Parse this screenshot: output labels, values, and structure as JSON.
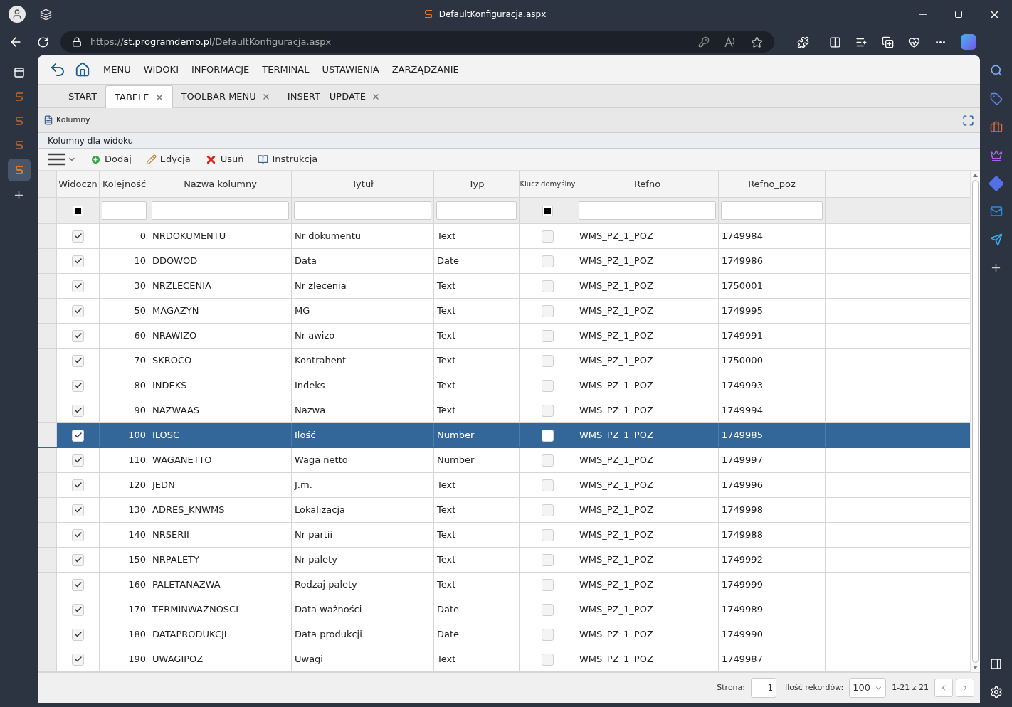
{
  "browser": {
    "title": "DefaultKonfiguracja.aspx",
    "url": {
      "scheme": "https://",
      "host": "st.programdemo.pl",
      "path": "/DefaultKonfiguracja.aspx"
    }
  },
  "nav": [
    "MENU",
    "WIDOKI",
    "INFORMACJE",
    "TERMINAL",
    "USTAWIENIA",
    "ZARZĄDZANIE"
  ],
  "tabs": [
    {
      "label": "START",
      "selected": false,
      "closable": false
    },
    {
      "label": "TABELE",
      "selected": true,
      "closable": true
    },
    {
      "label": "TOOLBAR MENU",
      "selected": false,
      "closable": true
    },
    {
      "label": "INSERT - UPDATE",
      "selected": false,
      "closable": true
    }
  ],
  "panel": {
    "title": "Kolumny",
    "subtitle": "Kolumny dla widoku"
  },
  "toolbar": [
    {
      "kind": "add",
      "label": "Dodaj"
    },
    {
      "kind": "edit",
      "label": "Edycja"
    },
    {
      "kind": "delete",
      "label": "Usuń"
    },
    {
      "kind": "help",
      "label": "Instrukcja"
    }
  ],
  "table": {
    "columns": [
      "Widoczn",
      "Kolejność",
      "Nazwa kolumny",
      "Tytuł",
      "Typ",
      "Klucz domyślny",
      "Refno",
      "Refno_poz"
    ],
    "filter": {
      "visible_checked": true,
      "key_checked": true
    },
    "rows": [
      {
        "visible": true,
        "order": "0",
        "name": "NRDOKUMENTU",
        "title": "Nr dokumentu",
        "type": "Text",
        "key": false,
        "refno": "WMS_PZ_1_POZ",
        "refno_poz": "1749984",
        "selected": false
      },
      {
        "visible": true,
        "order": "10",
        "name": "DDOWOD",
        "title": "Data",
        "type": "Date",
        "key": false,
        "refno": "WMS_PZ_1_POZ",
        "refno_poz": "1749986",
        "selected": false
      },
      {
        "visible": true,
        "order": "30",
        "name": "NRZLECENIA",
        "title": "Nr zlecenia",
        "type": "Text",
        "key": false,
        "refno": "WMS_PZ_1_POZ",
        "refno_poz": "1750001",
        "selected": false
      },
      {
        "visible": true,
        "order": "50",
        "name": "MAGAZYN",
        "title": "MG",
        "type": "Text",
        "key": false,
        "refno": "WMS_PZ_1_POZ",
        "refno_poz": "1749995",
        "selected": false
      },
      {
        "visible": true,
        "order": "60",
        "name": "NRAWIZO",
        "title": "Nr awizo",
        "type": "Text",
        "key": false,
        "refno": "WMS_PZ_1_POZ",
        "refno_poz": "1749991",
        "selected": false
      },
      {
        "visible": true,
        "order": "70",
        "name": "SKROCO",
        "title": "Kontrahent",
        "type": "Text",
        "key": false,
        "refno": "WMS_PZ_1_POZ",
        "refno_poz": "1750000",
        "selected": false
      },
      {
        "visible": true,
        "order": "80",
        "name": "INDEKS",
        "title": "Indeks",
        "type": "Text",
        "key": false,
        "refno": "WMS_PZ_1_POZ",
        "refno_poz": "1749993",
        "selected": false
      },
      {
        "visible": true,
        "order": "90",
        "name": "NAZWAAS",
        "title": "Nazwa",
        "type": "Text",
        "key": false,
        "refno": "WMS_PZ_1_POZ",
        "refno_poz": "1749994",
        "selected": false
      },
      {
        "visible": true,
        "order": "100",
        "name": "ILOSC",
        "title": "Ilość",
        "type": "Number",
        "key": false,
        "refno": "WMS_PZ_1_POZ",
        "refno_poz": "1749985",
        "selected": true
      },
      {
        "visible": true,
        "order": "110",
        "name": "WAGANETTO",
        "title": "Waga netto",
        "type": "Number",
        "key": false,
        "refno": "WMS_PZ_1_POZ",
        "refno_poz": "1749997",
        "selected": false
      },
      {
        "visible": true,
        "order": "120",
        "name": "JEDN",
        "title": "J.m.",
        "type": "Text",
        "key": false,
        "refno": "WMS_PZ_1_POZ",
        "refno_poz": "1749996",
        "selected": false
      },
      {
        "visible": true,
        "order": "130",
        "name": "ADRES_KNWMS",
        "title": "Lokalizacja",
        "type": "Text",
        "key": false,
        "refno": "WMS_PZ_1_POZ",
        "refno_poz": "1749998",
        "selected": false
      },
      {
        "visible": true,
        "order": "140",
        "name": "NRSERII",
        "title": "Nr partii",
        "type": "Text",
        "key": false,
        "refno": "WMS_PZ_1_POZ",
        "refno_poz": "1749988",
        "selected": false
      },
      {
        "visible": true,
        "order": "150",
        "name": "NRPALETY",
        "title": "Nr palety",
        "type": "Text",
        "key": false,
        "refno": "WMS_PZ_1_POZ",
        "refno_poz": "1749992",
        "selected": false
      },
      {
        "visible": true,
        "order": "160",
        "name": "PALETANAZWA",
        "title": "Rodzaj palety",
        "type": "Text",
        "key": false,
        "refno": "WMS_PZ_1_POZ",
        "refno_poz": "1749999",
        "selected": false
      },
      {
        "visible": true,
        "order": "170",
        "name": "TERMINWAZNOSCI",
        "title": "Data ważności",
        "type": "Date",
        "key": false,
        "refno": "WMS_PZ_1_POZ",
        "refno_poz": "1749989",
        "selected": false
      },
      {
        "visible": true,
        "order": "180",
        "name": "DATAPRODUKCJI",
        "title": "Data produkcji",
        "type": "Date",
        "key": false,
        "refno": "WMS_PZ_1_POZ",
        "refno_poz": "1749990",
        "selected": false
      },
      {
        "visible": true,
        "order": "190",
        "name": "UWAGIPOZ",
        "title": "Uwagi",
        "type": "Text",
        "key": false,
        "refno": "WMS_PZ_1_POZ",
        "refno_poz": "1749987",
        "selected": false
      }
    ]
  },
  "pager": {
    "page_label": "Strona:",
    "page": "1",
    "records_label": "Ilość rekordów:",
    "records": "100",
    "range": "1-21 z 21"
  }
}
